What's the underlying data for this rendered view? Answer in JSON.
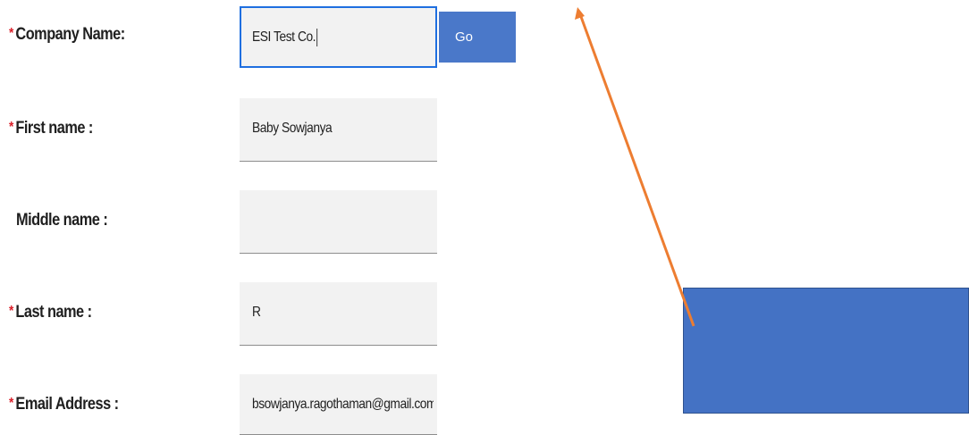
{
  "form": {
    "required_marker": "*",
    "company": {
      "label": "Company Name:",
      "value": "ESI Test Co.",
      "focused": true
    },
    "go_button": {
      "label": "Go"
    },
    "first_name": {
      "label": "First name :",
      "value": "Baby Sowjanya"
    },
    "middle_name": {
      "label": "Middle name :",
      "value": ""
    },
    "last_name": {
      "label": "Last name :",
      "value": "R"
    },
    "email": {
      "label": "Email Address :",
      "value": "bsowjanya.ragothaman@gmail.com"
    }
  },
  "annotation": {
    "arrow_color": "#ed7d31",
    "box_color": "#4472c4"
  },
  "colors": {
    "accent": "#4a78c9",
    "focus_border": "#1f6fe0",
    "required": "#da1e28",
    "field_bg": "#f2f2f2"
  }
}
